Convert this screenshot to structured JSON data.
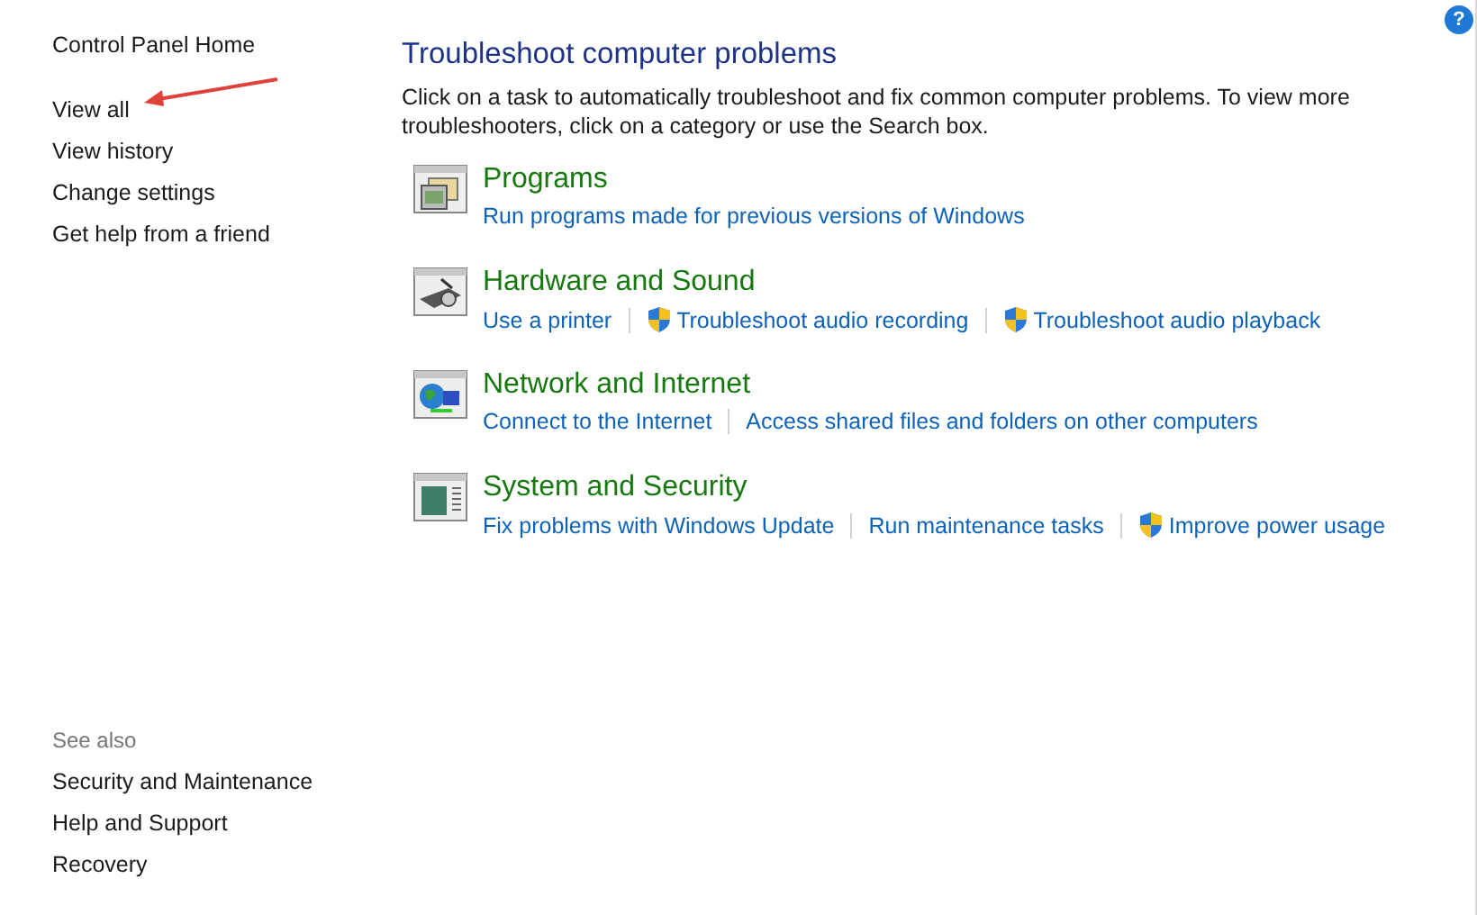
{
  "sidebar": {
    "top_links": [
      {
        "label": "Control Panel Home"
      },
      {
        "label": "View all"
      },
      {
        "label": "View history"
      },
      {
        "label": "Change settings"
      },
      {
        "label": "Get help from a friend"
      }
    ],
    "see_also": {
      "heading": "See also",
      "links": [
        {
          "label": "Security and Maintenance"
        },
        {
          "label": "Help and Support"
        },
        {
          "label": "Recovery"
        }
      ]
    }
  },
  "help_button": {
    "label": "?"
  },
  "main": {
    "title": "Troubleshoot computer problems",
    "description": "Click on a task to automatically troubleshoot and fix common computer problems. To view more troubleshooters, click on a category or use the Search box.",
    "categories": [
      {
        "kind": "programs",
        "title": "Programs",
        "links": [
          {
            "label": "Run programs made for previous versions of Windows",
            "shield": false
          }
        ]
      },
      {
        "kind": "hardware",
        "title": "Hardware and Sound",
        "links": [
          {
            "label": "Use a printer",
            "shield": false
          },
          {
            "label": "Troubleshoot audio recording",
            "shield": true
          },
          {
            "label": "Troubleshoot audio playback",
            "shield": true
          }
        ]
      },
      {
        "kind": "network",
        "title": "Network and Internet",
        "links": [
          {
            "label": "Connect to the Internet",
            "shield": false
          },
          {
            "label": "Access shared files and folders on other computers",
            "shield": false
          }
        ]
      },
      {
        "kind": "system",
        "title": "System and Security",
        "links": [
          {
            "label": "Fix problems with Windows Update",
            "shield": false
          },
          {
            "label": "Run maintenance tasks",
            "shield": false
          },
          {
            "label": "Improve power usage",
            "shield": true
          }
        ]
      }
    ]
  }
}
